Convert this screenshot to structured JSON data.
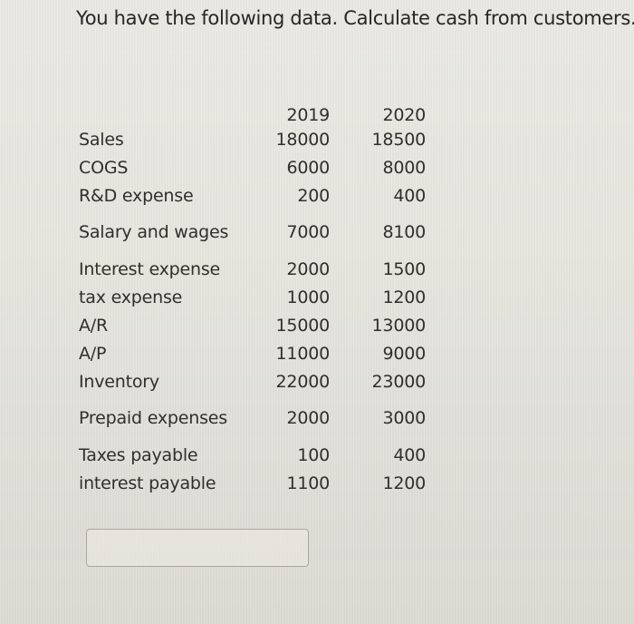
{
  "question": "You have the following data. Calculate cash from customers.",
  "table": {
    "headers": [
      "",
      "2019",
      "2020"
    ],
    "rows": [
      {
        "label": "Sales",
        "y2019": "18000",
        "y2020": "18500"
      },
      {
        "label": "COGS",
        "y2019": "6000",
        "y2020": "8000"
      },
      {
        "label": "R&D expense",
        "y2019": "200",
        "y2020": "400"
      },
      {
        "label": "Salary and wages",
        "y2019": "7000",
        "y2020": "8100"
      },
      {
        "label": "Interest expense",
        "y2019": "2000",
        "y2020": "1500"
      },
      {
        "label": "tax expense",
        "y2019": "1000",
        "y2020": "1200"
      },
      {
        "label": "A/R",
        "y2019": "15000",
        "y2020": "13000"
      },
      {
        "label": "A/P",
        "y2019": "11000",
        "y2020": "9000"
      },
      {
        "label": "Inventory",
        "y2019": "22000",
        "y2020": "23000"
      },
      {
        "label": "Prepaid expenses",
        "y2019": "2000",
        "y2020": "3000"
      },
      {
        "label": "Taxes payable",
        "y2019": "100",
        "y2020": "400"
      },
      {
        "label": "interest payable",
        "y2019": "1100",
        "y2020": "1200"
      }
    ]
  },
  "answer": {
    "value": "",
    "placeholder": ""
  }
}
